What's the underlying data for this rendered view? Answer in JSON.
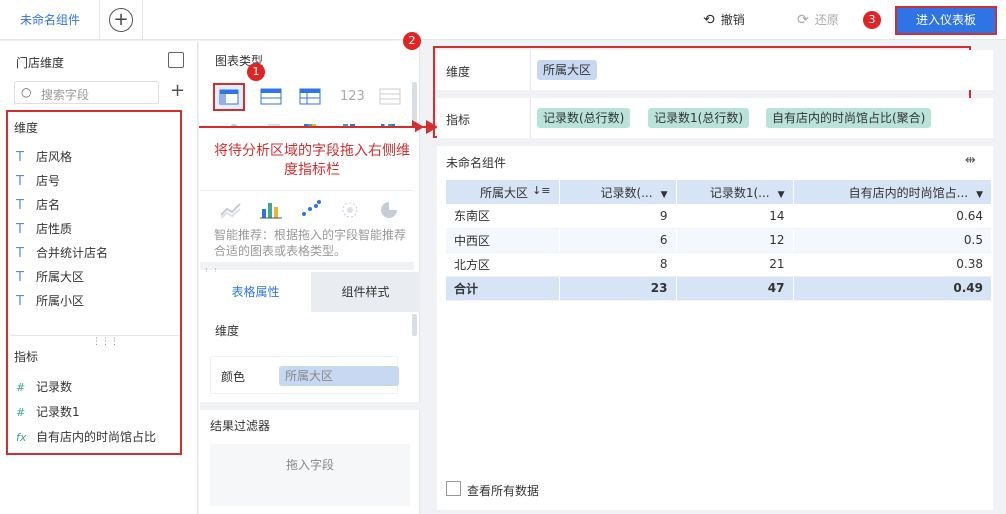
{
  "topbar": {
    "tab_label": "未命名组件",
    "add_tab": "+",
    "undo_label": "撤销",
    "redo_label": "还原",
    "enter_dashboard_label": "进入仪表板"
  },
  "badges": [
    "1",
    "2",
    "3"
  ],
  "left": {
    "title": "门店维度",
    "search_placeholder": "搜索字段",
    "add": "+",
    "dimension_heading": "维度",
    "dimensions": [
      "店风格",
      "店号",
      "店名",
      "店性质",
      "合并统计店名",
      "所属大区",
      "所属小区"
    ],
    "dimension_icon": "T",
    "measure_heading": "指标",
    "measures": [
      {
        "icon": "#",
        "label": "记录数"
      },
      {
        "icon": "#",
        "label": "记录数1"
      },
      {
        "icon": "fx",
        "label": "自有店内的时尚馆占比"
      }
    ]
  },
  "middle": {
    "chart_type_label": "图表类型",
    "annotation": "将待分析区域的字段拖入右侧维度指标栏",
    "smart_text": "智能推荐：根据拖入的字段智能推荐合适的图表或表格类型。",
    "num_icon_label": "123",
    "tabs": [
      "表格属性",
      "组件样式"
    ],
    "dimension_label": "维度",
    "color_label": "颜色",
    "color_chip": "所属大区",
    "filter_label": "结果过滤器",
    "filter_drop": "拖入字段"
  },
  "right": {
    "dimension_label": "维度",
    "dimension_chip": "所属大区",
    "measure_label": "指标",
    "measure_chips": [
      "记录数(总行数)",
      "记录数1(总行数)",
      "自有店内的时尚馆占比(聚合)"
    ],
    "component_title": "未命名组件",
    "expand_icon": "⇹",
    "table": {
      "headers": [
        "所属大区",
        "记录数(...",
        "记录数1(...",
        "自有店内的时尚馆占..."
      ],
      "rows": [
        [
          "东南区",
          "9",
          "14",
          "0.64"
        ],
        [
          "中西区",
          "6",
          "12",
          "0.5"
        ],
        [
          "北方区",
          "8",
          "21",
          "0.38"
        ]
      ],
      "total": [
        "合计",
        "23",
        "47",
        "0.49"
      ]
    },
    "view_all_label": "查看所有数据"
  },
  "colors": {
    "accent": "#2f74e6",
    "annotation_red": "#d32f2f",
    "header_blue": "#d6e4f6",
    "chip_teal": "#b9e3d9"
  }
}
